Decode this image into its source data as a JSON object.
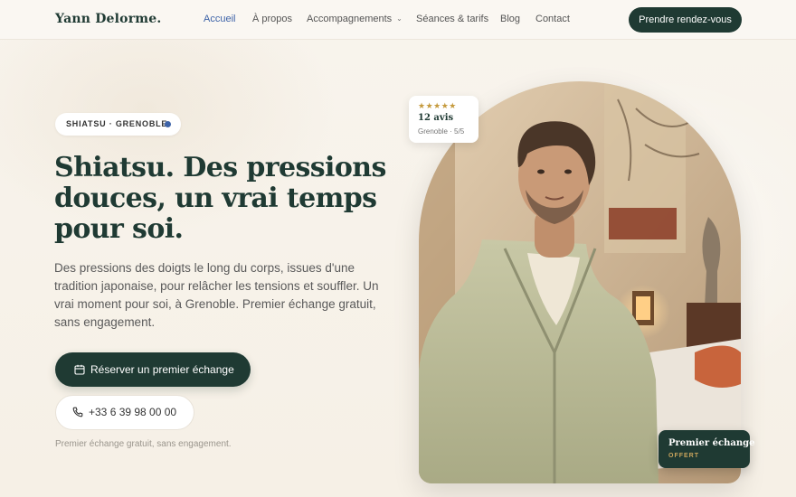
{
  "header": {
    "logo": "Yann Delorme.",
    "nav": [
      {
        "label": "Accueil",
        "active": true
      },
      {
        "label": "À propos",
        "active": false
      },
      {
        "label": "Accompagnements",
        "active": false,
        "dropdown": true
      },
      {
        "label": "Séances & tarifs",
        "active": false
      },
      {
        "label": "Blog",
        "active": false
      },
      {
        "label": "Contact",
        "active": false
      }
    ],
    "cta_label": "Prendre rendez-vous"
  },
  "hero": {
    "badge": "SHIATSU · GRENOBLE",
    "title": "Shiatsu. Des pressions douces, un vrai temps pour soi.",
    "text": "Des pressions des doigts le long du corps, issues d'une tradition japonaise, pour relâcher les tensions et souffler. Un vrai moment pour soi, à Grenoble. Premier échange gratuit, sans engagement.",
    "primary_button": "Réserver un premier échange",
    "phone_button": "+33 6 39 98 00 00",
    "note": "Premier échange gratuit, sans engagement."
  },
  "review_card": {
    "stars": "★★★★★",
    "count": "12 avis",
    "meta": "Grenoble · 5/5"
  },
  "offer_card": {
    "title": "Premier échange",
    "subtitle": "OFFERT"
  },
  "colors": {
    "brand": "#1f3a33",
    "accent": "#3d63a8",
    "background": "#f7f2ea"
  }
}
